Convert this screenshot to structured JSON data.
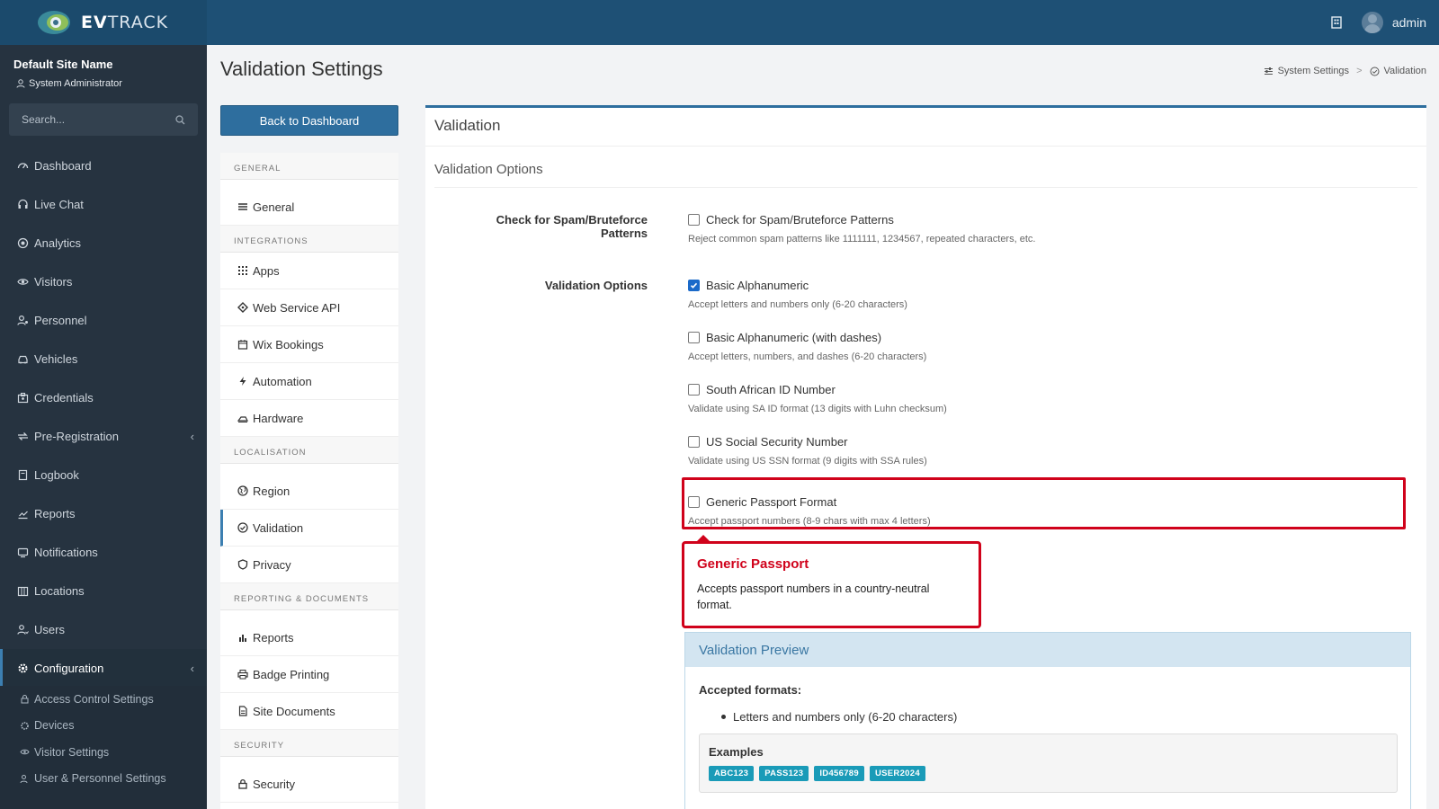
{
  "brand": {
    "bold": "EV",
    "light": "TRACK"
  },
  "topbar": {
    "username": "admin"
  },
  "sidebar": {
    "site_name": "Default Site Name",
    "role": "System Administrator",
    "search_placeholder": "Search...",
    "items": [
      {
        "label": "Dashboard",
        "icon": "dashboard-icon"
      },
      {
        "label": "Live Chat",
        "icon": "headset-icon"
      },
      {
        "label": "Analytics",
        "icon": "target-icon"
      },
      {
        "label": "Visitors",
        "icon": "eye-icon"
      },
      {
        "label": "Personnel",
        "icon": "user-cog-icon"
      },
      {
        "label": "Vehicles",
        "icon": "car-icon"
      },
      {
        "label": "Credentials",
        "icon": "id-badge-icon"
      },
      {
        "label": "Pre-Registration",
        "icon": "exchange-icon"
      },
      {
        "label": "Logbook",
        "icon": "book-icon"
      },
      {
        "label": "Reports",
        "icon": "chart-icon"
      },
      {
        "label": "Notifications",
        "icon": "bell-icon"
      },
      {
        "label": "Locations",
        "icon": "building-icon"
      },
      {
        "label": "Users",
        "icon": "users-icon"
      },
      {
        "label": "Configuration",
        "icon": "gear-icon"
      }
    ],
    "subitems": [
      {
        "label": "Access Control Settings",
        "icon": "lock-icon"
      },
      {
        "label": "Devices",
        "icon": "cog-icon"
      },
      {
        "label": "Visitor Settings",
        "icon": "eye-icon"
      },
      {
        "label": "User & Personnel Settings",
        "icon": "users-icon"
      }
    ]
  },
  "page": {
    "title": "Validation Settings",
    "breadcrumb": {
      "parent": "System Settings",
      "current": "Validation"
    },
    "back_button": "Back to Dashboard"
  },
  "settings_nav": {
    "general_header": "GENERAL",
    "general_items": [
      "General"
    ],
    "integrations_header": "INTEGRATIONS",
    "integrations_items": [
      "Apps",
      "Web Service API",
      "Wix Bookings",
      "Automation",
      "Hardware"
    ],
    "localisation_header": "LOCALISATION",
    "localisation_items": [
      "Region",
      "Validation",
      "Privacy"
    ],
    "reporting_header": "REPORTING & DOCUMENTS",
    "reporting_items": [
      "Reports",
      "Badge Printing",
      "Site Documents"
    ],
    "security_header": "SECURITY",
    "security_items": [
      "Security"
    ]
  },
  "card": {
    "title": "Validation",
    "section_title": "Validation Options",
    "spam_label": "Check for Spam/Bruteforce Patterns",
    "spam_option": "Check for Spam/Bruteforce Patterns",
    "spam_hint": "Reject common spam patterns like 1111111, 1234567, repeated characters, etc.",
    "options_label": "Validation Options",
    "options": [
      {
        "label": "Basic Alphanumeric",
        "hint": "Accept letters and numbers only (6-20 characters)",
        "checked": true
      },
      {
        "label": "Basic Alphanumeric (with dashes)",
        "hint": "Accept letters, numbers, and dashes (6-20 characters)",
        "checked": false
      },
      {
        "label": "South African ID Number",
        "hint": "Validate using SA ID format (13 digits with Luhn checksum)",
        "checked": false
      },
      {
        "label": "US Social Security Number",
        "hint": "Validate using US SSN format (9 digits with SSA rules)",
        "checked": false
      },
      {
        "label": "Generic Passport Format",
        "hint": "Accept passport numbers (8-9 chars with max 4 letters)",
        "checked": false
      }
    ]
  },
  "tooltip": {
    "title": "Generic Passport",
    "body": "Accepts passport numbers in a country-neutral format."
  },
  "preview": {
    "title": "Validation Preview",
    "accepted_label": "Accepted formats:",
    "formats": [
      "Letters and numbers only (6-20 characters)"
    ],
    "examples_title": "Examples",
    "examples": [
      "ABC123",
      "PASS123",
      "ID456789",
      "USER2024"
    ]
  },
  "colors": {
    "primary": "#2e6e9e",
    "highlight": "#d0021b",
    "sidebar": "#263340",
    "tag": "#1a9bb8"
  }
}
